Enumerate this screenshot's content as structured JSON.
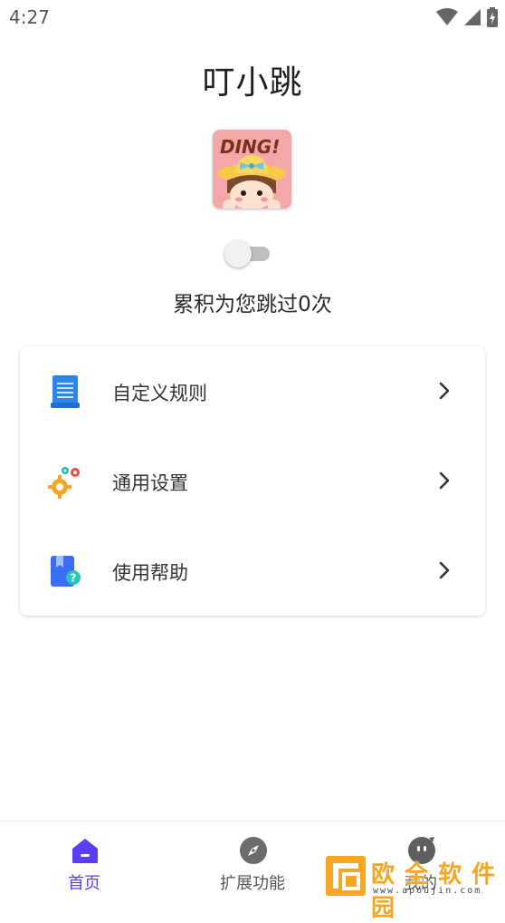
{
  "status_bar": {
    "time": "4:27",
    "icons": [
      "wifi-icon",
      "signal-icon",
      "battery-charging-icon"
    ]
  },
  "app": {
    "title": "叮小跳",
    "logo_text": "DING!",
    "logo_icon": "girl-with-hat-logo"
  },
  "toggle": {
    "state": "off"
  },
  "skip_count_text": "累积为您跳过0次",
  "menu": {
    "items": [
      {
        "label": "自定义规则",
        "icon": "document-list-icon"
      },
      {
        "label": "通用设置",
        "icon": "gears-icon"
      },
      {
        "label": "使用帮助",
        "icon": "help-book-icon"
      }
    ]
  },
  "bottom_nav": {
    "items": [
      {
        "label": "首页",
        "icon": "home-icon",
        "active": true
      },
      {
        "label": "扩展功能",
        "icon": "compass-icon",
        "active": false
      },
      {
        "label": "我的",
        "icon": "profile-face-icon",
        "active": false
      }
    ]
  },
  "watermark": {
    "text": "欧 全 软 件 园",
    "url": "www.apoujin.com"
  },
  "colors": {
    "accent": "#5b3df5",
    "doc_icon": "#2b86e8",
    "help_icon": "#3a6ef2",
    "help_badge": "#24c6b8",
    "gear_orange": "#f5a623",
    "gear_red": "#e5533c",
    "gear_teal": "#22b7a9",
    "watermark": "#f5a623"
  }
}
